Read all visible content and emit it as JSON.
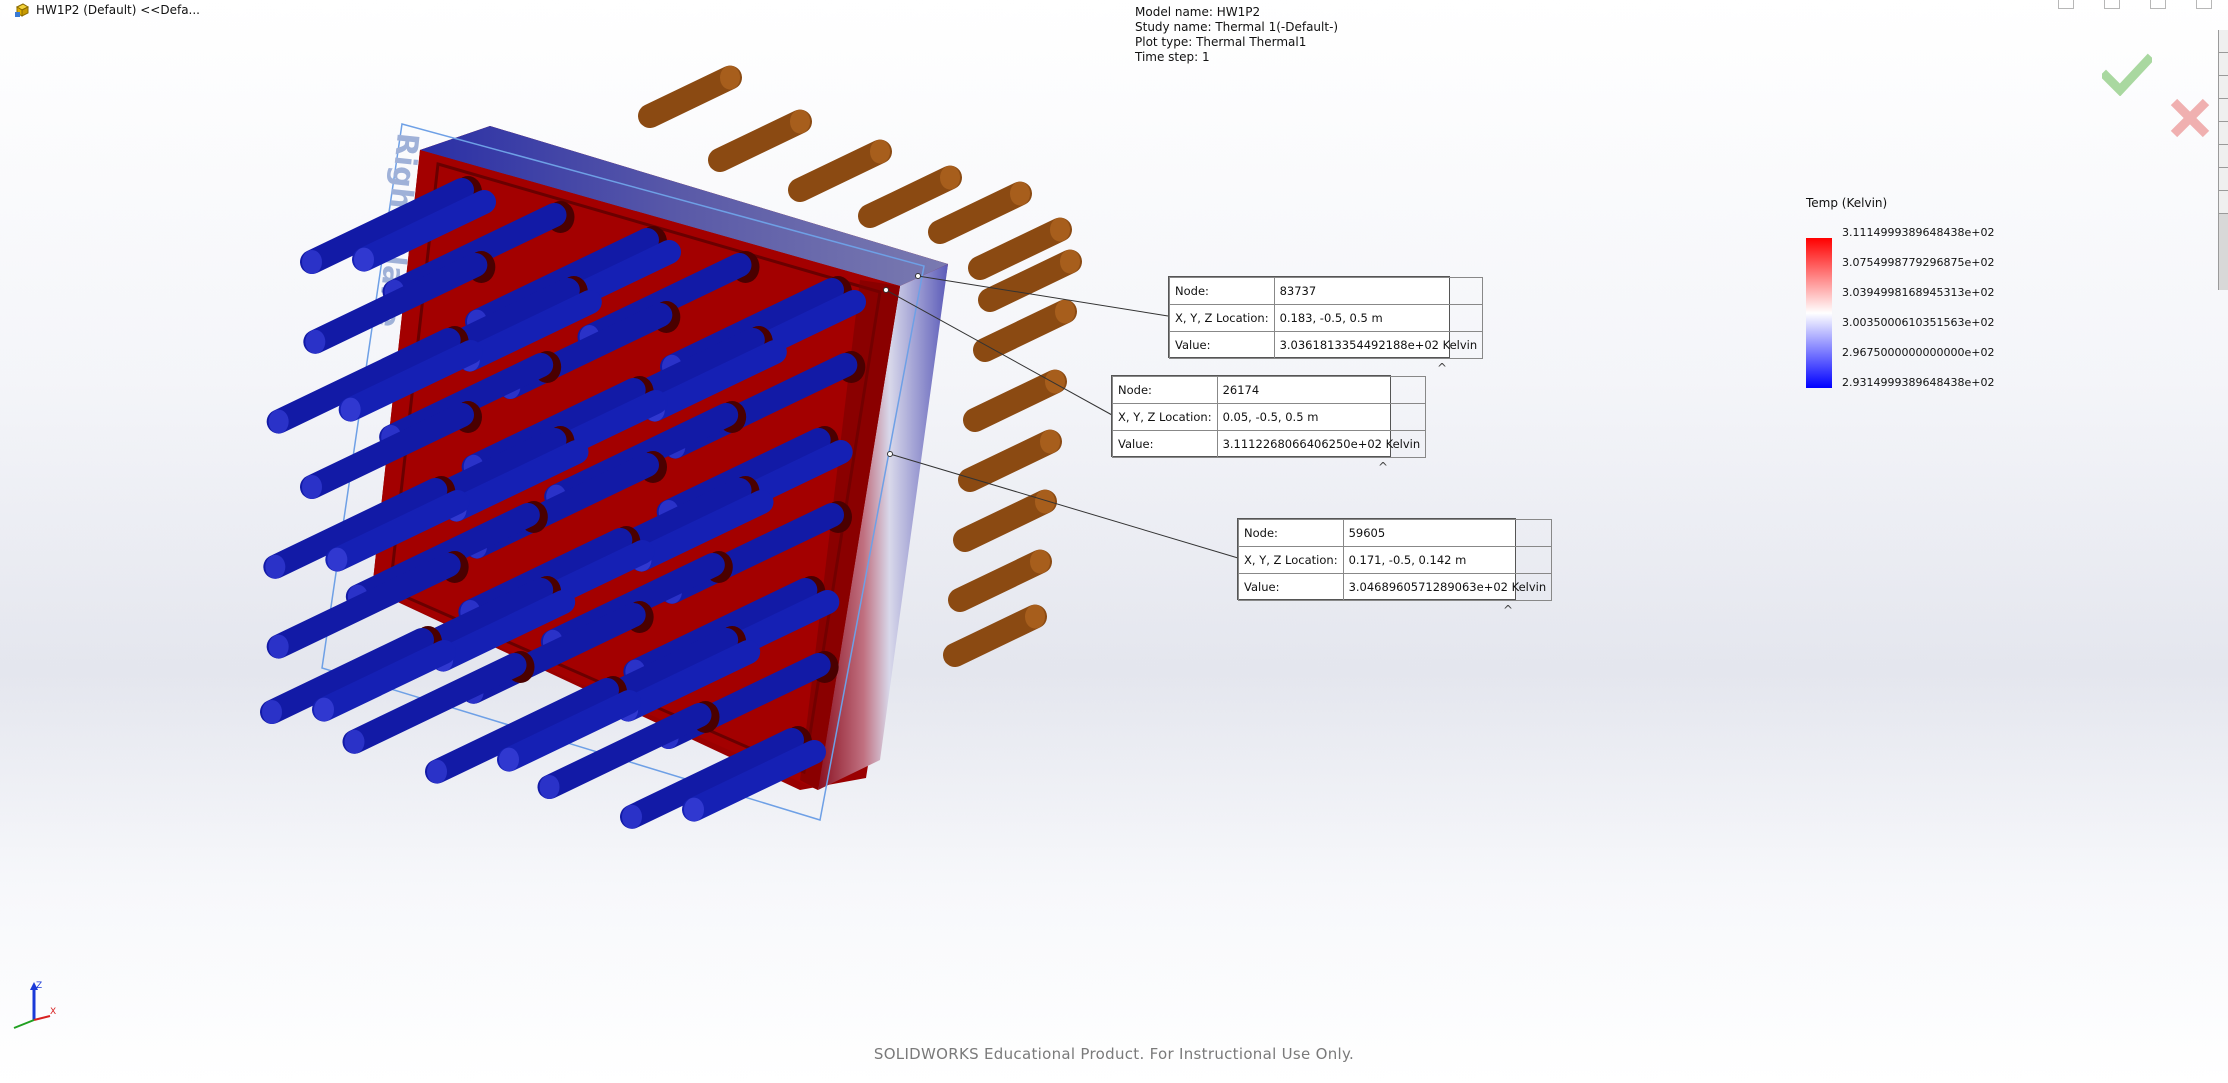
{
  "document": {
    "title": "HW1P2 (Default) <<Defa..."
  },
  "model_info": {
    "model_name": "Model name: HW1P2",
    "study_name": "Study name: Thermal 1(-Default-)",
    "plot_type": "Plot type: Thermal Thermal1",
    "time_step": "Time step: 1"
  },
  "legend": {
    "title": "Temp (Kelvin)",
    "ticks": [
      "3.1114999389648438e+02",
      "3.0754998779296875e+02",
      "3.0394998168945313e+02",
      "3.0035000610351563e+02",
      "2.9675000000000000e+02",
      "2.9314999389648438e+02"
    ],
    "colors": {
      "max": "#ff0000",
      "mid": "#ffffff",
      "min": "#0000ff"
    }
  },
  "probes": [
    {
      "node_label": "Node:",
      "node": "83737",
      "loc_label": "X, Y, Z Location:",
      "loc": "0.183, -0.5, 0.5 m",
      "value_label": "Value:",
      "value": "3.0361813354492188e+02 Kelvin"
    },
    {
      "node_label": "Node:",
      "node": "26174",
      "loc_label": "X, Y, Z Location:",
      "loc": "0.05, -0.5, 0.5 m",
      "value_label": "Value:",
      "value": "3.1112268066406250e+02 Kelvin"
    },
    {
      "node_label": "Node:",
      "node": "59605",
      "loc_label": "X, Y, Z Location:",
      "loc": "0.171, -0.5, 0.142 m",
      "value_label": "Value:",
      "value": "3.0468960571289063e+02 Kelvin"
    }
  ],
  "plane_label": "Right Plane",
  "triad": {
    "z": "Z",
    "x": "X"
  },
  "watermark": "SOLIDWORKS Educational Product. For Instructional Use Only.",
  "colors": {
    "plate_red": "#a00000",
    "pin_blue": "#101aa8",
    "pin_brown": "#8b4a12",
    "plane_outline": "#6ea0e6"
  },
  "icons": [
    "part-document-icon",
    "accept-check-icon",
    "cancel-x-icon",
    "triad-icon"
  ]
}
